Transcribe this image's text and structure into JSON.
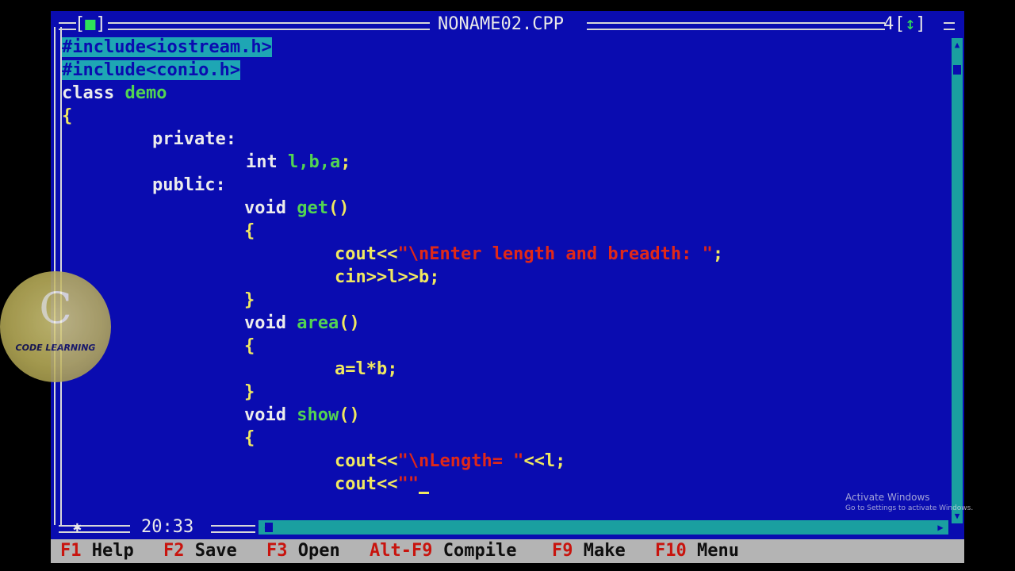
{
  "editor": {
    "close_box": "[",
    "close_box_indicator": "■",
    "close_box_end": "]",
    "filename": "NONAME02.CPP",
    "window_number": "4",
    "zoom_box": "[",
    "zoom_box_indicator": "↕",
    "zoom_box_end": "]",
    "cursor_position": "20:33"
  },
  "code": {
    "line1": "#include<iostream.h>",
    "line2": "#include<conio.h>",
    "line3_kw": "class",
    "line3_id": "demo",
    "line4": "{",
    "line5": "private:",
    "line6_kw": "int",
    "line6_id": "l,b,a",
    "line6_end": ";",
    "line7": "public:",
    "line8_kw": "void",
    "line8_id": "get",
    "line8_end": "()",
    "line9": "{",
    "line10_pre": "cout<<",
    "line10_str": "\"\\nEnter length and breadth: \"",
    "line10_end": ";",
    "line11": "cin>>l>>b;",
    "line12": "}",
    "line13_kw": "void",
    "line13_id": "area",
    "line13_end": "()",
    "line14": "{",
    "line15": "a=l*b;",
    "line16": "}",
    "line17_kw": "void",
    "line17_id": "show",
    "line17_end": "()",
    "line18": "{",
    "line19_pre": "cout<<",
    "line19_str": "\"\\nLength= \"",
    "line19_end": "<<l;",
    "line20_pre": "cout<<",
    "line20_str": "\"\""
  },
  "function_keys": [
    {
      "key": "F1",
      "label": "Help"
    },
    {
      "key": "F2",
      "label": "Save"
    },
    {
      "key": "F3",
      "label": "Open"
    },
    {
      "key": "Alt-F9",
      "label": "Compile"
    },
    {
      "key": "F9",
      "label": "Make"
    },
    {
      "key": "F10",
      "label": "Menu"
    }
  ],
  "logo": {
    "text": "CODE LEARNING"
  },
  "watermark": {
    "title": "Activate Windows",
    "subtitle": "Go to Settings to activate Windows."
  },
  "colors": {
    "editor_background": "#0a0cb0",
    "selection": "#1ea6b4",
    "identifier": "#52d452",
    "string": "#e02818",
    "operator": "#f0e860",
    "status_bar": "#b4b4b4",
    "hotkey": "#c8140e"
  }
}
